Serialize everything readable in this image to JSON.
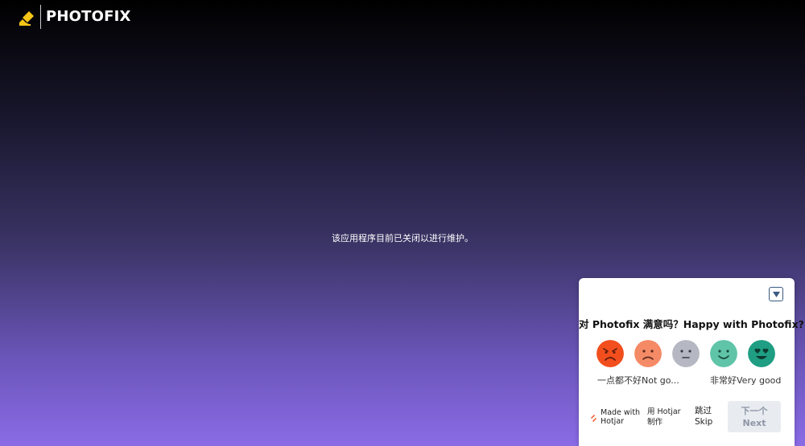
{
  "app": {
    "brand": "PHOTOFIX"
  },
  "main": {
    "maintenance_message": "该应用程序目前已关闭以进行维护。"
  },
  "survey": {
    "question": "对 Photofix 满意吗？Happy with Photofix?",
    "ratings": [
      {
        "name": "very-bad",
        "color": "#f24e1e"
      },
      {
        "name": "bad",
        "color": "#f58a66"
      },
      {
        "name": "neutral",
        "color": "#b5b8c2"
      },
      {
        "name": "good",
        "color": "#5fc4a8"
      },
      {
        "name": "very-good",
        "color": "#1f9e83"
      }
    ],
    "scale_low": "一点都不好Not go...",
    "scale_high": "非常好Very good",
    "made_with": "Made with Hotjar",
    "made_with_cn": "用 Hotjar 制作",
    "skip_label": "跳过 Skip",
    "next_label_cn": "下一个",
    "next_label": "Next"
  }
}
